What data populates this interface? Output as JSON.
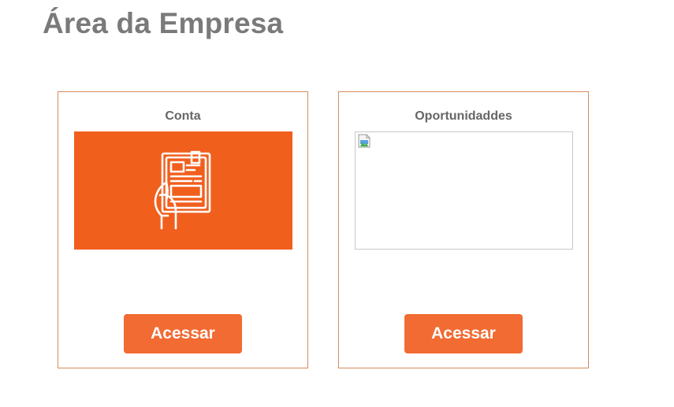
{
  "page": {
    "title": "Área da Empresa"
  },
  "cards": [
    {
      "title": "Conta",
      "image_icon": "document-in-hand-icon",
      "image_bg": "#f15f1d",
      "button_label": "Acessar"
    },
    {
      "title": "Oportunidaddes",
      "image_icon": "broken-image-icon",
      "button_label": "Acessar"
    }
  ],
  "colors": {
    "accent": "#f26b33",
    "card_border": "#d58c5a",
    "title_gray": "#7a7a7a"
  }
}
